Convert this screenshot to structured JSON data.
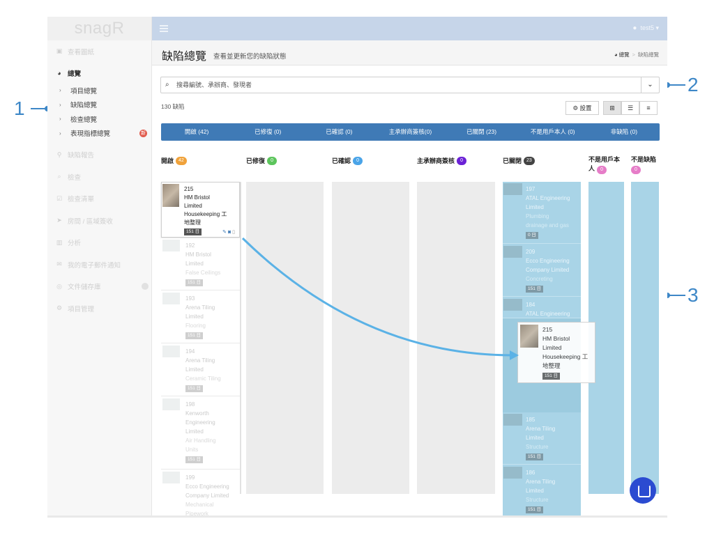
{
  "app": {
    "logo": "snagR",
    "user": "test5 ▾"
  },
  "sidebar": {
    "items": [
      {
        "icon": "image-icon",
        "label": "查看圖紙"
      },
      {
        "icon": "dashboard-icon",
        "label": "總覽",
        "active": true
      },
      {
        "icon": "pin-icon",
        "label": "缺陷報告"
      },
      {
        "icon": "search-icon",
        "label": "檢查"
      },
      {
        "icon": "checklist-icon",
        "label": "檢查清單"
      },
      {
        "icon": "send-icon",
        "label": "房間 / 區域簽收"
      },
      {
        "icon": "chart-icon",
        "label": "分析"
      },
      {
        "icon": "mail-icon",
        "label": "我的電子郵件通知"
      },
      {
        "icon": "storage-icon",
        "label": "文件儲存庫"
      },
      {
        "icon": "gears-icon",
        "label": "項目管理"
      }
    ],
    "subitems": [
      "項目總覽",
      "缺陷總覽",
      "檢查總覽",
      "表現指標總覽"
    ],
    "new_badge": "新"
  },
  "page": {
    "title": "缺陷總覽",
    "subtitle": "查看並更新您的缺陷狀態",
    "breadcrumb_home": "總覽",
    "breadcrumb_current": "缺陷總覽",
    "search_placeholder": "搜尋編號、承辦商、發現者",
    "count_label": "130 缺陷",
    "settings_label": "設置"
  },
  "tabs": [
    "開啟 (42)",
    "已修復 (0)",
    "已確認 (0)",
    "主承辦商簽核(0)",
    "已關閉 (23)",
    "不是用戶本人 (0)",
    "非缺陷 (0)"
  ],
  "columns": [
    {
      "name": "開啟",
      "count": "42",
      "color": "#f0a23a"
    },
    {
      "name": "已修復",
      "count": "0",
      "color": "#5cc55c"
    },
    {
      "name": "已確認",
      "count": "0",
      "color": "#4aa4e8"
    },
    {
      "name": "主承辦商簽核",
      "count": "0",
      "color": "#6b21d6"
    },
    {
      "name": "已關閉",
      "count": "23",
      "color": "#444444"
    },
    {
      "name": "不是用戶本",
      "name2": "人",
      "count": "0",
      "color": "#e67dc8"
    },
    {
      "name": "不是缺陷",
      "count": "0",
      "color": "#e67dc8"
    }
  ],
  "open_cards": [
    {
      "id": "215",
      "company": "HM Bristol",
      "company2": "Limited",
      "trade": "Housekeeping 工",
      "trade2": "地整理",
      "days": "151 日"
    },
    {
      "id": "192",
      "company": "HM Bristol",
      "company2": "Limited",
      "trade": "False Ceilings",
      "trade2": "",
      "days": "151 日"
    },
    {
      "id": "193",
      "company": "Arena Tiling",
      "company2": "Limited",
      "trade": "Flooring",
      "trade2": "",
      "days": "151 日"
    },
    {
      "id": "194",
      "company": "Arena Tiling",
      "company2": "Limited",
      "trade": "Ceramic Tiling",
      "trade2": "",
      "days": "151 日"
    },
    {
      "id": "198",
      "company": "Kenworth",
      "company2": "Engineering",
      "company3": "Limited",
      "trade": "Air Handling",
      "trade2": "Units",
      "days": "151 日"
    },
    {
      "id": "199",
      "company": "Ecco Engineering",
      "company2": "Company Limited",
      "trade": "Mechanical",
      "trade2": "Pipework",
      "days": "151 日"
    }
  ],
  "closed_cards": [
    {
      "id": "197",
      "company": "ATAL Engineering",
      "company2": "Limited",
      "trade": "Plumbing",
      "trade2": "drainage and gas",
      "days": "0 日"
    },
    {
      "id": "209",
      "company": "Ecco Engineering",
      "company2": "Company Limited",
      "trade": "Concreting",
      "days": "151 日"
    },
    {
      "id": "184",
      "company": "ATAL Engineering"
    },
    {
      "id": "185",
      "company": "Arena Tiling",
      "company2": "Limited",
      "trade": "Structure",
      "days": "151 日"
    },
    {
      "id": "186",
      "company": "Arena Tiling",
      "company2": "Limited",
      "trade": "Structure",
      "days": "151 日"
    }
  ],
  "drag_card": {
    "id": "215",
    "company": "HM Bristol",
    "company2": "Limited",
    "trade": "Housekeeping 工",
    "trade2": "地整理",
    "days": "151 日"
  },
  "callouts": [
    "1",
    "2",
    "3"
  ]
}
